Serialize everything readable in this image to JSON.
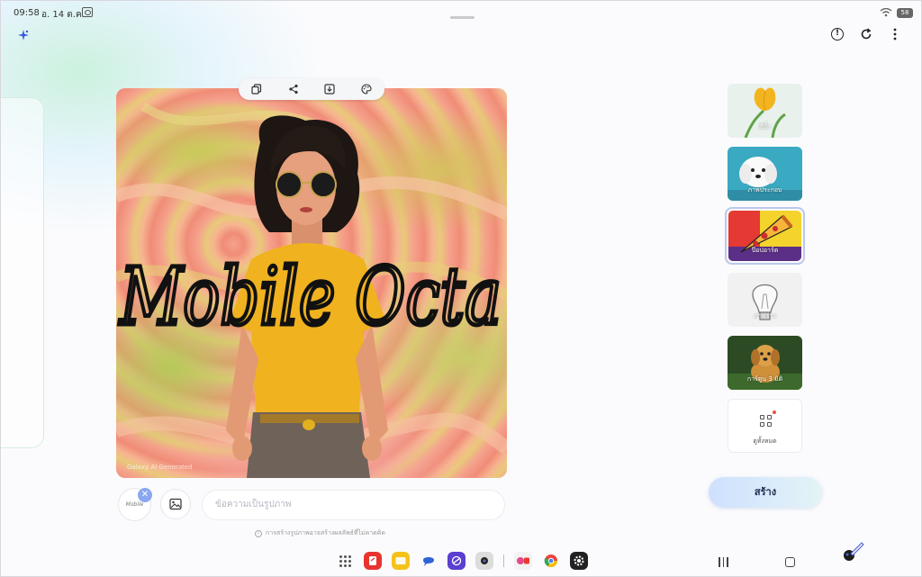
{
  "status": {
    "time": "09:58",
    "date": "อ. 14 ต.ค.",
    "battery": "58"
  },
  "canvas": {
    "overlay_text": "Mobile Octa",
    "watermark": "Galaxy AI Generated"
  },
  "toolbar": {
    "copy_icon": "copy-icon",
    "share_icon": "share-icon",
    "download_icon": "download-icon",
    "palette_icon": "palette-icon"
  },
  "prompt": {
    "sketch_label": "Mobile",
    "placeholder": "ข้อความเป็นรูปภาพ",
    "disclaimer": "การสร้างรูปภาพอาจสร้างผลลัพธ์ที่ไม่คาดคิด"
  },
  "styles": [
    {
      "label": "สีน้ำ",
      "colors": {
        "bg": "#e8f0ea",
        "accent": "#f5c234"
      }
    },
    {
      "label": "ภาพประกอบ",
      "colors": {
        "bg": "#3aa9c2",
        "accent": "#ffffff"
      }
    },
    {
      "label": "ป๊อปอาร์ต",
      "colors": {
        "bg": "#1f2d6b",
        "accent": "#f3c12a"
      },
      "selected": true
    },
    {
      "label": "ภาพร่าง",
      "colors": {
        "bg": "#eeeeee",
        "accent": "#999999"
      }
    },
    {
      "label": "การ์ตูน 3 มิติ",
      "colors": {
        "bg": "#2d4a22",
        "accent": "#d69a3c"
      }
    }
  ],
  "more": {
    "label": "ดูทั้งหมด"
  },
  "create_button": "สร้าง",
  "accent_color": "#8aa8ef"
}
